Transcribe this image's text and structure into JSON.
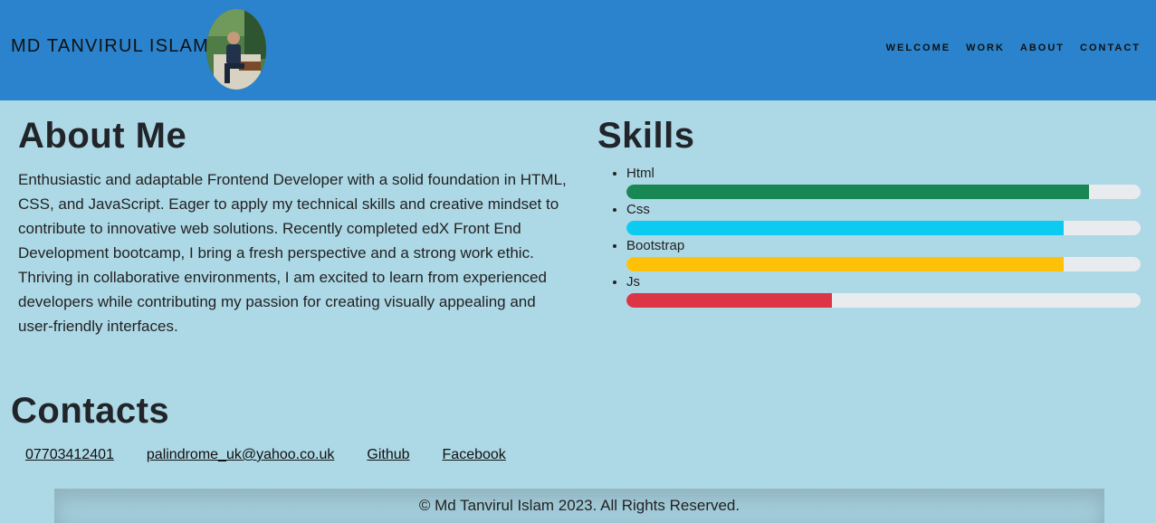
{
  "header": {
    "brand": "MD TANVIRUL ISLAM",
    "nav": [
      "WELCOME",
      "WORK",
      "ABOUT",
      "CONTACT"
    ],
    "accent": "#2a83cc"
  },
  "about": {
    "title": "About Me",
    "text": "Enthusiastic and adaptable Frontend Developer with a solid foundation in HTML, CSS, and JavaScript. Eager to apply my technical skills and creative mindset to contribute to innovative web solutions. Recently completed edX Front End Development bootcamp, I bring a fresh perspective and a strong work ethic. Thriving in collaborative environments, I am excited to learn from experienced developers while contributing my passion for creating visually appealing and user-friendly interfaces."
  },
  "skills": {
    "title": "Skills",
    "items": [
      {
        "label": "Html",
        "level": 0.9,
        "color": "#198754"
      },
      {
        "label": "Css",
        "level": 0.85,
        "color": "#0dcaf0"
      },
      {
        "label": "Bootstrap",
        "level": 0.85,
        "color": "#ffc107"
      },
      {
        "label": "Js",
        "level": 0.4,
        "color": "#dc3545"
      }
    ]
  },
  "contacts": {
    "title": "Contacts",
    "links": [
      "07703412401",
      "palindrome_uk@yahoo.co.uk",
      "Github",
      "Facebook"
    ]
  },
  "footer": {
    "text": "© Md Tanvirul Islam 2023. All Rights Reserved."
  }
}
